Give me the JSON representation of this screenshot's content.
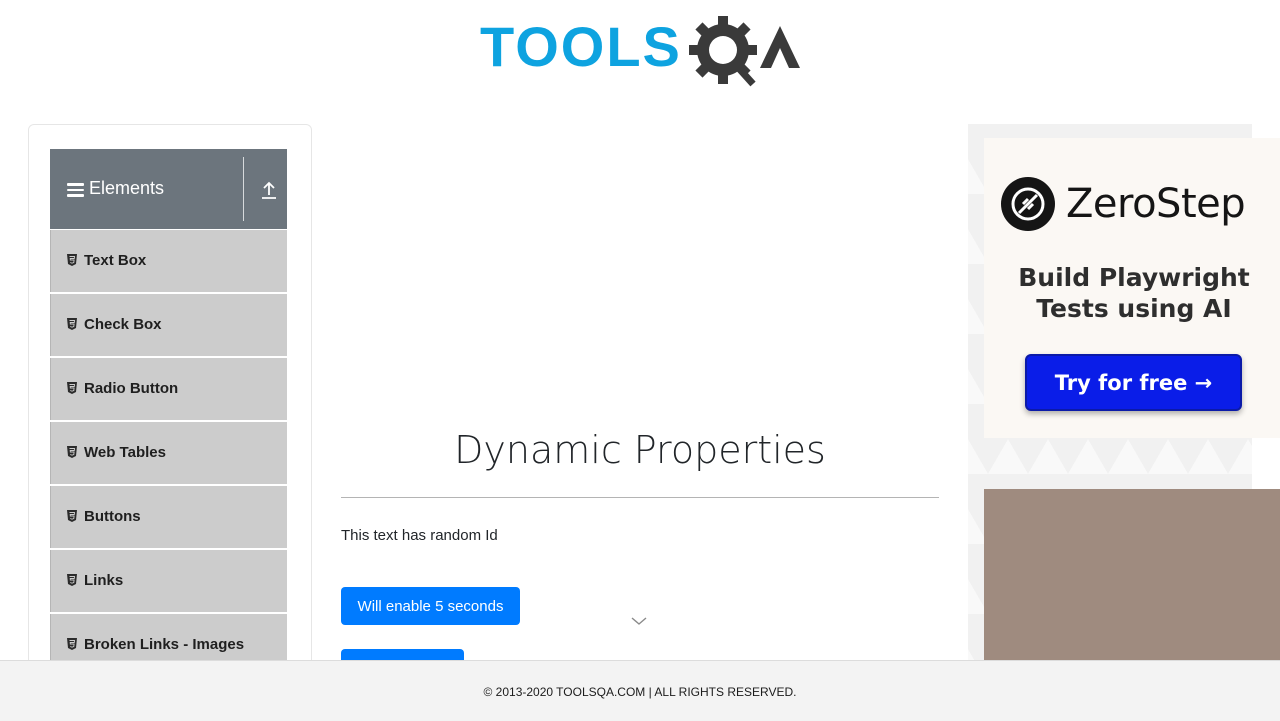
{
  "header": {
    "logo_text_left": "TOOLS",
    "logo_text_right": "QA",
    "logo_colors": {
      "tools": "#0ea3e0",
      "qa": "#3a3a3a"
    }
  },
  "sidebar": {
    "group_title": "Elements",
    "group_icon": "hamburger-icon",
    "collapse_icon": "upload-arrow-icon",
    "items": [
      {
        "label": "Text Box",
        "icon": "html5-icon"
      },
      {
        "label": "Check Box",
        "icon": "html5-icon"
      },
      {
        "label": "Radio Button",
        "icon": "html5-icon"
      },
      {
        "label": "Web Tables",
        "icon": "html5-icon"
      },
      {
        "label": "Buttons",
        "icon": "html5-icon"
      },
      {
        "label": "Links",
        "icon": "html5-icon"
      },
      {
        "label": "Broken Links - Images",
        "icon": "html5-icon"
      }
    ]
  },
  "main": {
    "page_title": "Dynamic Properties",
    "random_id_text": "This text has random Id",
    "enable_button_label": "Will enable 5 seconds",
    "scroll_hint_icon": "chevron-down-icon"
  },
  "ad": {
    "brand": "ZeroStep",
    "tagline": "Build Playwright Tests using AI",
    "cta_label": "Try for free →",
    "colors": {
      "cta": "#0a1de8",
      "card": "#fbf8f4",
      "lower": "#9f8b7f"
    }
  },
  "footer": {
    "copyright": "© 2013-2020 TOOLSQA.COM | ALL RIGHTS RESERVED."
  }
}
